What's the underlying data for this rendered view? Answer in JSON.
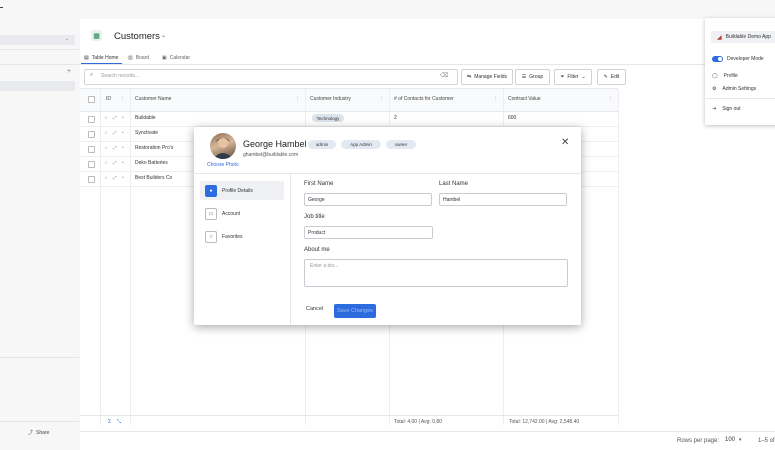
{
  "app": {
    "title": "Customers"
  },
  "tabs": [
    {
      "label": "Table Home"
    },
    {
      "label": "Board"
    },
    {
      "label": "Calendar"
    }
  ],
  "toolbar": {
    "search_placeholder": "Search records...",
    "manage_fields": "Manage Fields",
    "group": "Group",
    "filter": "Filter",
    "edit": "Edit"
  },
  "table": {
    "columns": [
      "ID",
      "Customer Name",
      "Customer Industry",
      "# of Contacts for Customer",
      "Contract Value"
    ],
    "rows": [
      {
        "name": "Buildable",
        "industry": "Technology",
        "contacts": "2",
        "value": "600"
      },
      {
        "name": "Synctivate",
        "industry": "",
        "contacts": "",
        "value": ""
      },
      {
        "name": "Restoration Pro's",
        "industry": "",
        "contacts": "",
        "value": ""
      },
      {
        "name": "Deko Batteries",
        "industry": "",
        "contacts": "",
        "value": ""
      },
      {
        "name": "Best Builders Co",
        "industry": "",
        "contacts": "",
        "value": ""
      }
    ],
    "totals": {
      "contacts": "Total: 4.00 | Avg: 0.80",
      "value": "Total: 12,742.00 | Avg: 2,548.40"
    }
  },
  "pager": {
    "rows_per_page_label": "Rows per page:",
    "rows_per_page": "100",
    "range": "1–5 of"
  },
  "sidebar": {
    "share": "Share"
  },
  "user_menu": {
    "org": "Buildable Demo App",
    "developer_mode": "Developer Mode",
    "profile": "Profile",
    "admin_settings": "Admin Settings",
    "sign_out": "Sign out"
  },
  "modal": {
    "name": "George Hambel",
    "email": "ghambel@buildable.com",
    "choose_photo": "Choose Photo",
    "roles": [
      "admin",
      "App Admin",
      "owner"
    ],
    "side_items": [
      "Profile Details",
      "Account",
      "Favorites"
    ],
    "fields": {
      "first_name_label": "First Name",
      "first_name": "George",
      "last_name_label": "Last Name",
      "last_name": "Hambel",
      "job_title_label": "Job title",
      "job_title": "Product",
      "about_label": "About me",
      "about_placeholder": "Enter a bio..."
    },
    "cancel": "Cancel",
    "save": "Save Changes"
  }
}
